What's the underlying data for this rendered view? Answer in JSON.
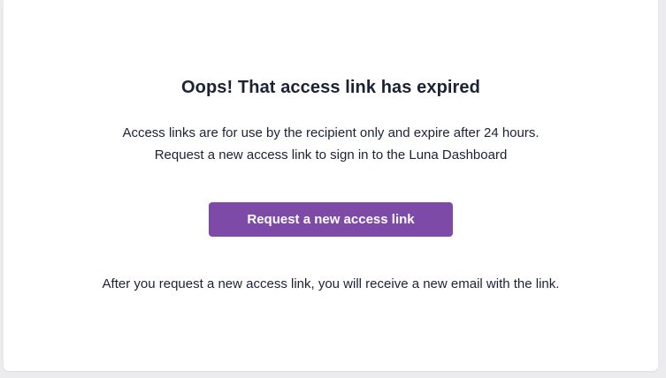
{
  "message": {
    "title": "Oops! That access link has expired",
    "description_line1": "Access links are for use by the recipient only and expire after 24 hours.",
    "description_line2": "Request a new access link to sign in to the Luna Dashboard",
    "request_button_label": "Request a new access link",
    "after_note": "After you request a new access link, you will receive a new email with the link."
  },
  "colors": {
    "background": "#ececee",
    "card": "#ffffff",
    "text": "#1b2236",
    "button": "#7d4aa8",
    "button_text": "#ffffff"
  }
}
